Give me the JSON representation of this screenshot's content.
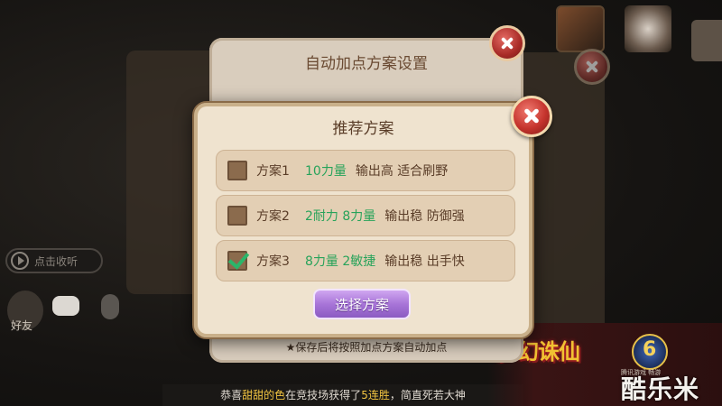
{
  "outer_dialog": {
    "title": "自动加点方案设置",
    "footer_note": "★保存后将按照加点方案自动加点"
  },
  "modal": {
    "title": "推荐方案",
    "schemes": [
      {
        "name": "方案1",
        "stats": "10力量",
        "desc": "输出高 适合刷野",
        "checked": false
      },
      {
        "name": "方案2",
        "stats": "2耐力 8力量",
        "desc": "输出稳 防御强",
        "checked": false
      },
      {
        "name": "方案3",
        "stats": "8力量 2敏捷",
        "desc": "输出稳 出手快",
        "checked": true
      }
    ],
    "select_button": "选择方案"
  },
  "background": {
    "play_chip": "点击收听",
    "friend_label": "好友",
    "banner": {
      "prefix": "恭喜",
      "player": "甜甜的色",
      "middle": "在竞技场获得了",
      "streak": "5连胜",
      "suffix": "，简直死若大神"
    },
    "logo_text": "梦幻诛仙",
    "logo_caption": "腾讯游戏 畅游",
    "watermark": "酷乐米"
  },
  "colors": {
    "stats_green": "#27a35a",
    "modal_bg": "#efe3cf",
    "button_purple": "#a875d8",
    "close_red": "#c5342d"
  },
  "icons": {
    "close": "close-icon",
    "checkbox": "checkbox-icon",
    "check": "checkmark-icon",
    "play": "play-icon",
    "chat": "chat-icon",
    "mic": "microphone-icon"
  }
}
